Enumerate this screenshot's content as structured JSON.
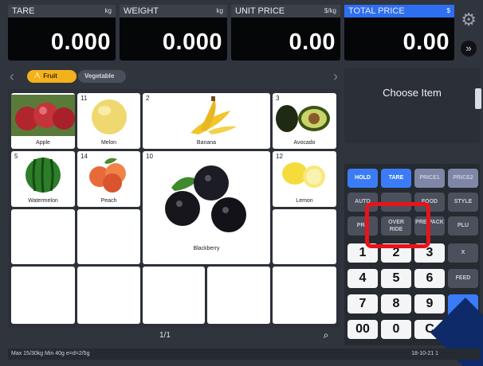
{
  "readouts": {
    "tare": {
      "label": "TARE",
      "unit": "kg",
      "value": "0.000"
    },
    "weight": {
      "label": "WEIGHT",
      "unit": "kg",
      "value": "0.000"
    },
    "unit_price": {
      "label": "UNIT PRICE",
      "unit": "$/kg",
      "value": "0.00"
    },
    "total_price": {
      "label": "TOTAL PRICE",
      "unit": "$",
      "value": "0.00"
    }
  },
  "indicators": [
    "",
    ""
  ],
  "categories": {
    "fruit": "Fruit",
    "vegetable": "Vegetable"
  },
  "products": [
    {
      "num": "",
      "name": "Apple"
    },
    {
      "num": "11",
      "name": "Melon"
    },
    {
      "num": "2",
      "name": "Banana"
    },
    {
      "num": "3",
      "name": "Avocado"
    },
    {
      "num": "5",
      "name": "Watermelon"
    },
    {
      "num": "14",
      "name": "Peach"
    },
    {
      "num": "10",
      "name": "Blackberry"
    },
    {
      "num": "12",
      "name": "Lemon"
    }
  ],
  "pagination": "1/1",
  "choose_item": "Choose Item",
  "keys": {
    "r1": [
      "HOLD",
      "TARE",
      "PRICE1",
      "PRICE2"
    ],
    "r2": [
      "AUTO",
      "",
      "FOOD",
      "STYLE"
    ],
    "r3": [
      "PRE",
      "OVER RIDE",
      "PRE PACK",
      "PLU"
    ],
    "num1": [
      "1",
      "2",
      "3",
      "X"
    ],
    "num2": [
      "4",
      "5",
      "6",
      "FEED"
    ],
    "num3": [
      "7",
      "8",
      "9",
      ""
    ],
    "num4": [
      "00",
      "0",
      "C",
      ""
    ]
  },
  "status": {
    "text": "Max 15/30kg  Min 40g  e=d=2/5g",
    "date": "18-10-21 1"
  },
  "colors": {
    "accent": "#3b7cf6",
    "fruit_tab": "#f3b21c",
    "highlight": "#e8131a",
    "arrow": "#0e2a68"
  }
}
